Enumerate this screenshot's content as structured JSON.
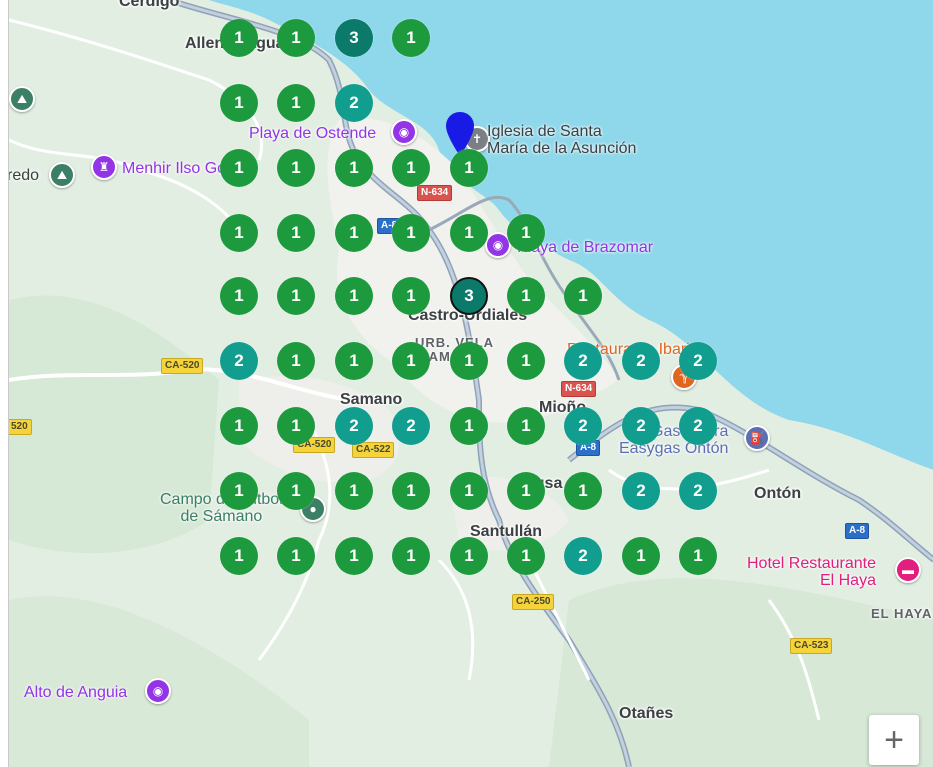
{
  "map": {
    "place_labels": [
      {
        "id": "cerdigo",
        "text": "Cerdigo"
      },
      {
        "id": "allendelagua",
        "text": "Allendelagua"
      },
      {
        "id": "castro",
        "text": "Castro-Urdiales"
      },
      {
        "id": "samano",
        "text": "Samano"
      },
      {
        "id": "miono",
        "text": "Mioño"
      },
      {
        "id": "santullan",
        "text": "Santullán"
      },
      {
        "id": "onton",
        "text": "Ontón"
      },
      {
        "id": "otanes",
        "text": "Otañes"
      },
      {
        "id": "lusa",
        "text": "Lusa"
      },
      {
        "id": "redo",
        "text": "redo"
      }
    ],
    "poi_labels": [
      {
        "id": "playa-ostende",
        "text": "Playa de Ostende",
        "kind": "purple"
      },
      {
        "id": "iglesia",
        "text": "Iglesia de Santa\nMaría de la Asunción",
        "kind": "gray"
      },
      {
        "id": "menhir",
        "text": "Menhir Ilso Gorde",
        "kind": "purple"
      },
      {
        "id": "playa-brazomar",
        "text": "Playa de Brazomar",
        "kind": "purple"
      },
      {
        "id": "restaurante",
        "text": "Restaurante Ibaria",
        "kind": "orange"
      },
      {
        "id": "gasolinera",
        "text": "Gasolinera\nEasygas Ontón",
        "kind": "blue"
      },
      {
        "id": "campo",
        "text": "Campo de Fútbol\nde Sámano",
        "kind": "green"
      },
      {
        "id": "hotel",
        "text": "Hotel Restaurante\nEl Haya",
        "kind": "pink"
      },
      {
        "id": "alto",
        "text": "Alto de Anguia",
        "kind": "purple"
      }
    ],
    "district_labels": [
      {
        "id": "urb-vela",
        "text": "URB. VELA"
      },
      {
        "id": "samano-d",
        "text": "SAMANO"
      },
      {
        "id": "el-haya",
        "text": "EL HAYA"
      }
    ],
    "road_shields": [
      {
        "id": "n634-top",
        "text": "N-634",
        "color": "red"
      },
      {
        "id": "a8-top",
        "text": "A-8",
        "color": "blue"
      },
      {
        "id": "ca520-left",
        "text": "CA-520",
        "color": "yellow"
      },
      {
        "id": "ca520-edge",
        "text": "520",
        "color": "yellow"
      },
      {
        "id": "n634-mid",
        "text": "N-634",
        "color": "red"
      },
      {
        "id": "ca520-mid",
        "text": "CA-520",
        "color": "yellow"
      },
      {
        "id": "ca522",
        "text": "CA-522",
        "color": "yellow"
      },
      {
        "id": "a8-mid",
        "text": "A-8",
        "color": "blue"
      },
      {
        "id": "a8-right",
        "text": "A-8",
        "color": "blue"
      },
      {
        "id": "ca250",
        "text": "CA-250",
        "color": "yellow"
      },
      {
        "id": "ca523",
        "text": "CA-523",
        "color": "yellow"
      }
    ],
    "cluster_rows": [
      [
        "1",
        "1",
        "3",
        "1"
      ],
      [
        "1",
        "1",
        "2"
      ],
      [
        "1",
        "1",
        "1",
        "1",
        "1"
      ],
      [
        "1",
        "1",
        "1",
        "1",
        "1",
        "1"
      ],
      [
        "1",
        "1",
        "1",
        "1",
        "3",
        "1",
        "1"
      ],
      [
        "2",
        "1",
        "1",
        "1",
        "1",
        "1",
        "2",
        "2",
        "2"
      ],
      [
        "1",
        "1",
        "2",
        "2",
        "1",
        "1",
        "2",
        "2",
        "2"
      ],
      [
        "1",
        "1",
        "1",
        "1",
        "1",
        "1",
        "1",
        "2",
        "2"
      ],
      [
        "1",
        "1",
        "1",
        "1",
        "1",
        "1",
        "2",
        "1",
        "1"
      ]
    ],
    "colors": {
      "cluster_1": "#1e9a3e",
      "cluster_2": "#119e8f",
      "cluster_3": "#0b7a6a",
      "water": "#8fd7ea",
      "land": "#e3eee3"
    },
    "zoom_in_label": "+"
  }
}
